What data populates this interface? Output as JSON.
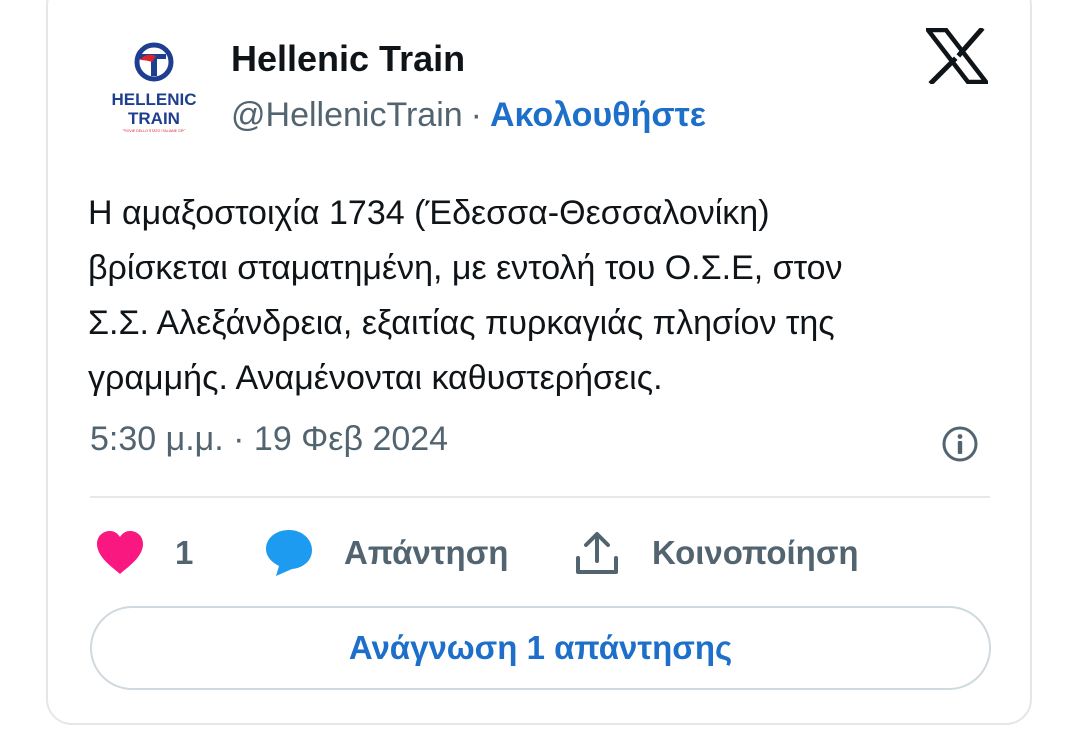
{
  "author": {
    "name": "Hellenic Train",
    "handle": "@HellenicTrain",
    "separator": "·",
    "follow_label": "Ακολουθήστε",
    "logo": {
      "line1": "HELLENIC",
      "line2": "TRAIN",
      "tagline": "FERROVIE DELLO STATO ITALIANE GROUP",
      "colors": {
        "blue": "#1e3f8f",
        "red": "#d7262f"
      }
    }
  },
  "platform_icon": "x-logo-icon",
  "tweet": {
    "lines": [
      "Η αμαξοστοιχία 1734 (Έδεσσα-Θεσσαλονίκη)",
      "βρίσκεται σταματημένη, με εντολή του Ο.Σ.Ε, στον",
      "Σ.Σ. Αλεξάνδρεια, εξαιτίας πυρκαγιάς πλησίον της",
      "γραμμής. Αναμένονται καθυστερήσεις."
    ],
    "timestamp": "5:30 μ.μ. · 19 Φεβ 2024"
  },
  "actions": {
    "like_count": "1",
    "reply_label": "Απάντηση",
    "share_label": "Κοινοποίηση"
  },
  "read_replies_label": "Ανάγνωση 1 απάντησης",
  "colors": {
    "like": "#f91880",
    "reply": "#1d9bf0",
    "link": "#1d6fc9",
    "muted": "#536471",
    "text": "#0f1419"
  }
}
